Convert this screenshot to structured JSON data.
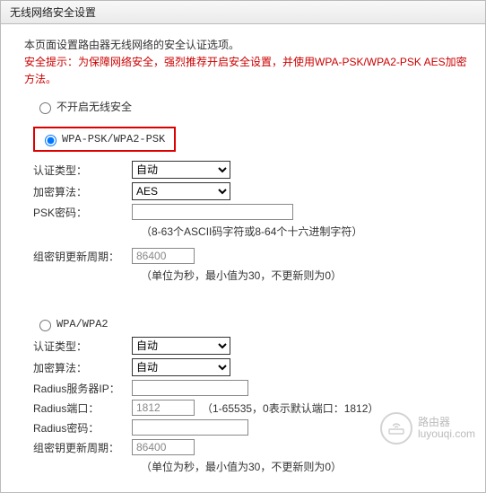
{
  "panel": {
    "title": "无线网络安全设置"
  },
  "intro": "本页面设置路由器无线网络的安全认证选项。",
  "warning": "安全提示：为保障网络安全，强烈推荐开启安全设置，并使用WPA-PSK/WPA2-PSK AES加密方法。",
  "sections": {
    "disable": {
      "label": "不开启无线安全"
    },
    "wpapsk": {
      "label": "WPA-PSK/WPA2-PSK",
      "auth_type_label": "认证类型：",
      "auth_type_value": "自动",
      "encryption_label": "加密算法：",
      "encryption_value": "AES",
      "psk_label": "PSK密码：",
      "psk_value": "",
      "psk_hint": "（8-63个ASCII码字符或8-64个十六进制字符）",
      "rekey_label": "组密钥更新周期：",
      "rekey_value": "86400",
      "rekey_hint": "（单位为秒，最小值为30，不更新则为0）"
    },
    "wpa": {
      "label": "WPA/WPA2",
      "auth_type_label": "认证类型：",
      "auth_type_value": "自动",
      "encryption_label": "加密算法：",
      "encryption_value": "自动",
      "radius_ip_label": "Radius服务器IP：",
      "radius_ip_value": "",
      "radius_port_label": "Radius端口：",
      "radius_port_value": "1812",
      "radius_port_hint": "（1-65535，0表示默认端口：1812）",
      "radius_pwd_label": "Radius密码：",
      "radius_pwd_value": "",
      "rekey_label": "组密钥更新周期：",
      "rekey_value": "86400",
      "rekey_hint": "（单位为秒，最小值为30，不更新则为0）"
    }
  },
  "watermark": {
    "title": "路由器",
    "url": "luyouqi.com"
  }
}
